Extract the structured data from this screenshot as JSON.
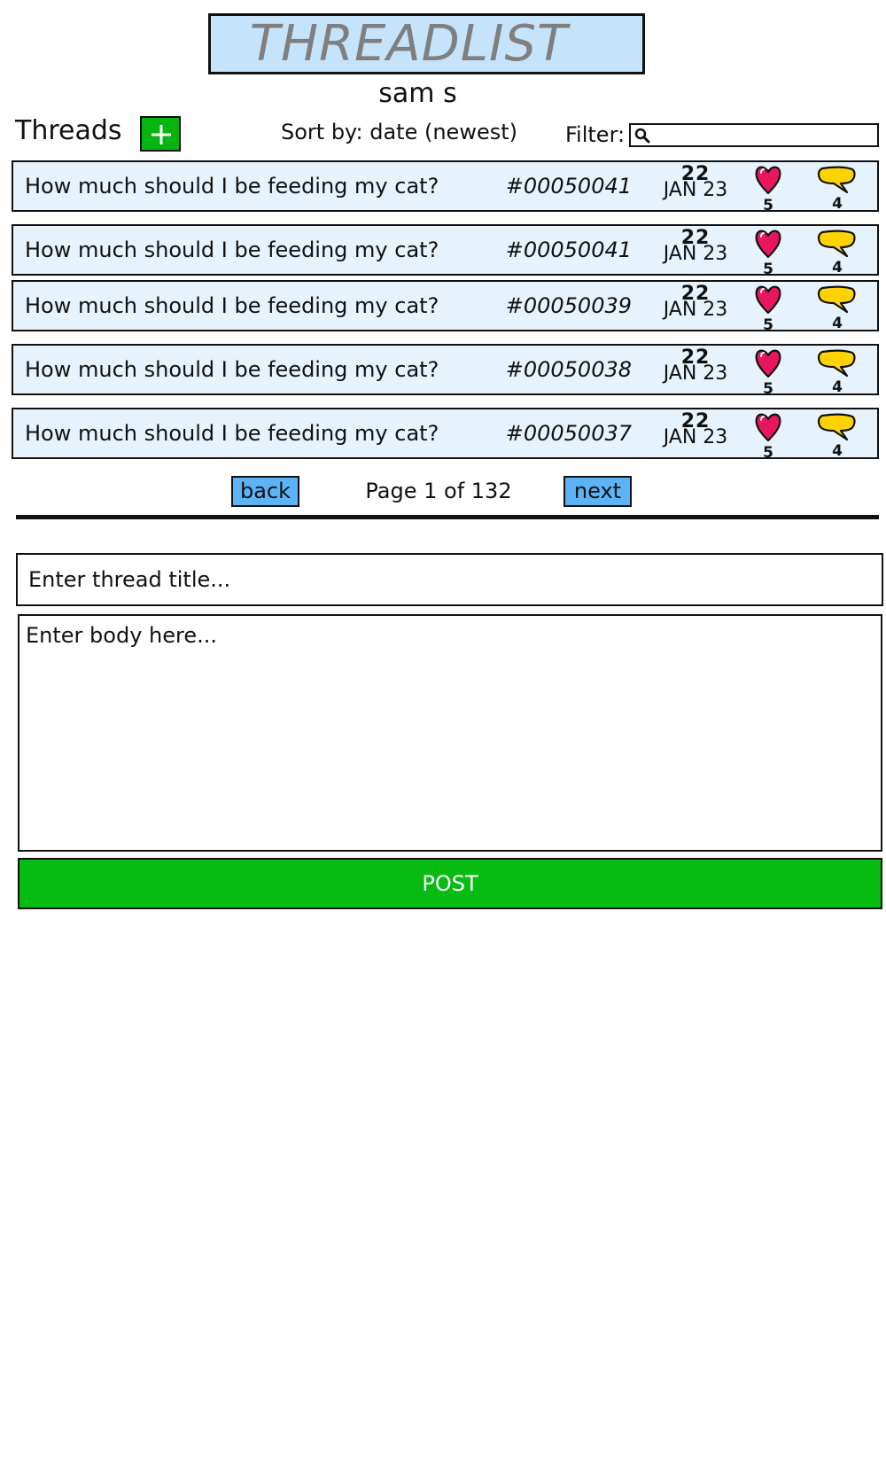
{
  "header": {
    "app_title": "THREADLIST",
    "username": "sam s"
  },
  "toolbar": {
    "threads_label": "Threads",
    "sort_label": "Sort by: date (newest)",
    "filter_label": "Filter:",
    "filter_value": ""
  },
  "threads": [
    {
      "title": "How much should I be feeding my cat?",
      "id": "#00050041",
      "day": "22",
      "month": "JAN 23",
      "likes": "5",
      "replies": "4"
    },
    {
      "title": "How much should I be feeding my cat?",
      "id": "#00050041",
      "day": "22",
      "month": "JAN 23",
      "likes": "5",
      "replies": "4"
    },
    {
      "title": "How much should I be feeding my cat?",
      "id": "#00050039",
      "day": "22",
      "month": "JAN 23",
      "likes": "5",
      "replies": "4"
    },
    {
      "title": "How much should I be feeding my cat?",
      "id": "#00050038",
      "day": "22",
      "month": "JAN 23",
      "likes": "5",
      "replies": "4"
    },
    {
      "title": "How much should I be feeding my cat?",
      "id": "#00050037",
      "day": "22",
      "month": "JAN 23",
      "likes": "5",
      "replies": "4"
    }
  ],
  "pagination": {
    "back_label": "back",
    "page_text": "Page 1 of 132",
    "next_label": "next"
  },
  "compose": {
    "title_placeholder": "Enter thread title...",
    "body_placeholder": "Enter body here...",
    "post_label": "POST"
  },
  "icons": {
    "add": "plus-icon",
    "search": "search-icon",
    "like": "heart-icon",
    "reply": "speech-bubble-icon"
  },
  "colors": {
    "title_bg": "#c5e4fb",
    "row_bg": "#e6f3fc",
    "add_button": "#06b512",
    "page_button": "#5cb3f5",
    "post_button": "#06bb12",
    "heart": "#e8175d",
    "bubble": "#ffd200"
  }
}
